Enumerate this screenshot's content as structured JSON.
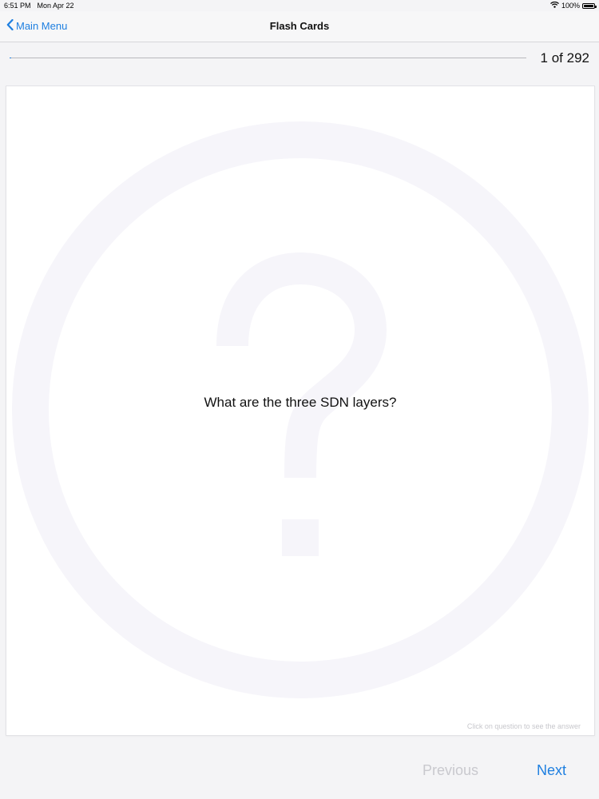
{
  "status_bar": {
    "time": "6:51 PM",
    "date": "Mon Apr 22",
    "battery": "100%",
    "battery_level": 1.0,
    "wifi_icon": "wifi-icon"
  },
  "nav": {
    "back_label": "Main Menu",
    "back_icon": "chevron-left-icon",
    "title": "Flash Cards"
  },
  "progress": {
    "current": 1,
    "total": 292,
    "label": "1 of 292"
  },
  "card": {
    "question": "What are the three SDN layers?",
    "hint": "Click on question to see the answer",
    "watermark_icon": "question-mark-icon"
  },
  "footer": {
    "previous_label": "Previous",
    "next_label": "Next"
  },
  "colors": {
    "accent": "#1e7fe0",
    "disabled": "#c9c9ce",
    "background": "#f4f4f6"
  }
}
